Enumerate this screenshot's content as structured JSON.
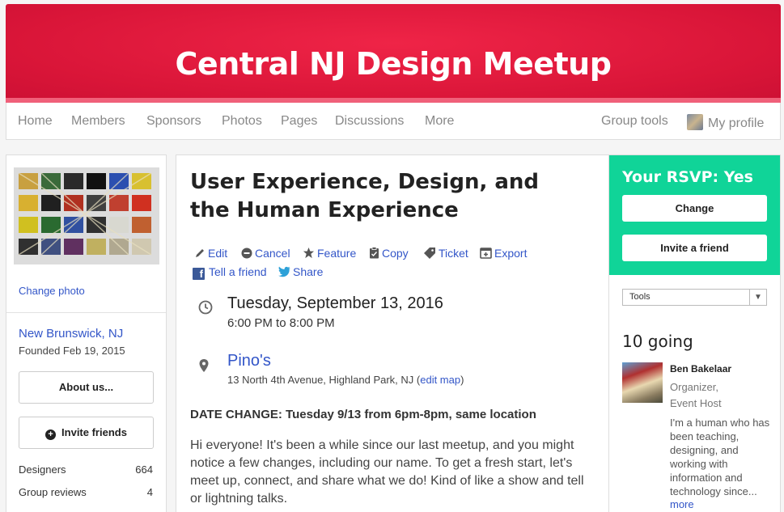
{
  "banner": {
    "title": "Central NJ Design Meetup"
  },
  "nav": {
    "items": [
      "Home",
      "Members",
      "Sponsors",
      "Photos",
      "Pages",
      "Discussions",
      "More"
    ],
    "group_tools": "Group tools",
    "my_profile": "My profile"
  },
  "sidebar": {
    "change_photo": "Change photo",
    "location": "New Brunswick, NJ",
    "founded": "Founded Feb 19, 2015",
    "about_button": "About us...",
    "invite_button": "Invite friends",
    "stats": [
      {
        "label": "Designers",
        "value": "664"
      },
      {
        "label": "Group reviews",
        "value": "4"
      }
    ]
  },
  "event": {
    "title": "User Experience, Design, and the Human Experience",
    "actions": {
      "edit": "Edit",
      "cancel": "Cancel",
      "feature": "Feature",
      "copy": "Copy",
      "ticket": "Ticket",
      "export": "Export",
      "tell_friend": "Tell a friend",
      "share": "Share"
    },
    "date": "Tuesday, September 13, 2016",
    "time": "6:00 PM to 8:00 PM",
    "venue": "Pino's",
    "address": "13 North 4th Avenue, Highland Park, NJ (",
    "edit_map": "edit map",
    "address_end": ")",
    "notice": "DATE CHANGE: Tuesday 9/13 from 6pm-8pm, same location",
    "description": "Hi everyone! It's been a while since our last meetup, and you might notice a few changes, including our name. To get a fresh start, let's meet up, connect, and share what we do! Kind of like a show and tell or lightning talks."
  },
  "rsvp": {
    "title": "Your RSVP: Yes",
    "change_button": "Change",
    "invite_button": "Invite a friend",
    "tools_select": "Tools"
  },
  "attendees": {
    "going": "10 going",
    "host": {
      "name": "Ben Bakelaar",
      "role1": "Organizer,",
      "role2": "Event Host",
      "bio": "I'm a human who has been teaching, designing, and working with information and technology since...",
      "more": "more"
    }
  },
  "colors": {
    "brand_red": "#e0193e",
    "rsvp_green": "#10d498",
    "link_blue": "#3356c8"
  }
}
